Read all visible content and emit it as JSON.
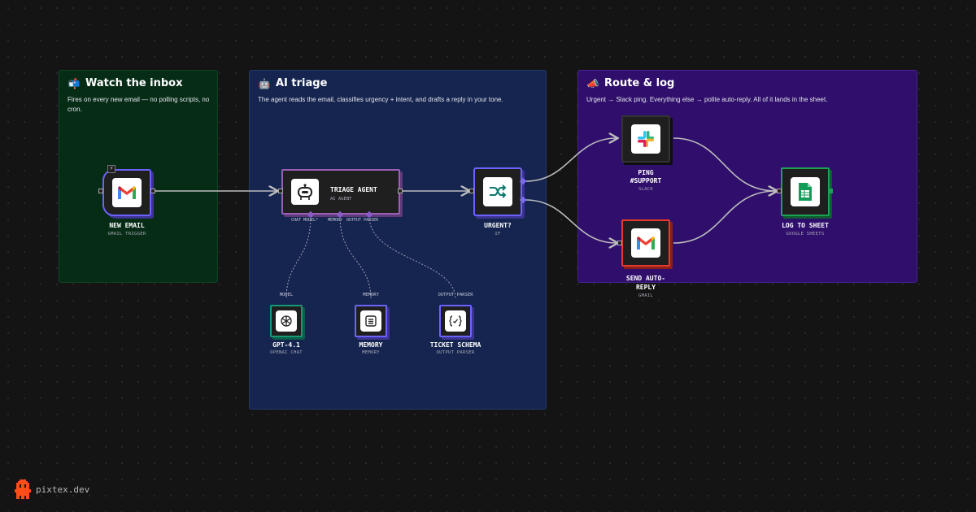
{
  "groups": {
    "watch": {
      "emoji": "📬",
      "title": "Watch the inbox",
      "desc": "Fires on every new email — no polling scripts, no cron."
    },
    "ai": {
      "emoji": "🤖",
      "title": "AI triage",
      "desc": "The agent reads the email, classifies urgency + intent, and drafts a reply in your tone."
    },
    "route": {
      "emoji": "📣",
      "title": "Route & log",
      "desc": "Urgent → Slack ping. Everything else → polite auto-reply. All of it lands in the sheet."
    }
  },
  "nodes": {
    "new_email": {
      "title": "NEW EMAIL",
      "subtitle": "GMAIL TRIGGER",
      "badge": "⚡",
      "icon": "gmail-icon"
    },
    "triage_agent": {
      "title": "TRIAGE AGENT",
      "subtitle": "AI AGENT",
      "icon": "robot-icon",
      "ports": [
        "CHAT MODEL*",
        "MEMORY",
        "OUTPUT PARSER"
      ]
    },
    "urgent": {
      "title": "URGENT?",
      "subtitle": "IF",
      "icon": "branch-icon"
    },
    "gpt": {
      "top_label": "MODEL",
      "title": "GPT-4.1",
      "subtitle": "OPENAI CHAT",
      "icon": "openai-icon"
    },
    "memory": {
      "top_label": "MEMORY",
      "title": "MEMORY",
      "subtitle": "MEMORY",
      "icon": "memory-icon"
    },
    "ticket_schema": {
      "top_label": "OUTPUT PARSER",
      "title": "TICKET SCHEMA",
      "subtitle": "OUTPUT PARSER",
      "icon": "json-braces-icon"
    },
    "ping_support": {
      "title_line1": "PING",
      "title_line2": "#SUPPORT",
      "subtitle": "SLACK",
      "icon": "slack-icon"
    },
    "send_reply": {
      "title_line1": "SEND AUTO-",
      "title_line2": "REPLY",
      "subtitle": "GMAIL",
      "icon": "gmail-icon"
    },
    "log_sheet": {
      "title": "LOG TO SHEET",
      "subtitle": "GOOGLE SHEETS",
      "icon": "google-sheets-icon"
    }
  },
  "brand": {
    "name": "pixtex.dev",
    "icon": "pixel-mascot-icon"
  },
  "colors": {
    "background": "#141414",
    "watch_group": "#062c16",
    "ai_group": "#15254f",
    "route_group": "#2f0f6b",
    "trigger_border": "#6c63ff",
    "agent_border": "#9b5fb8",
    "openai_border": "#129b74",
    "slack_border": "#333333",
    "gmail_send_border": "#e63a2e",
    "sheets_border": "#1ea055",
    "wire": "#bdbdbd"
  }
}
